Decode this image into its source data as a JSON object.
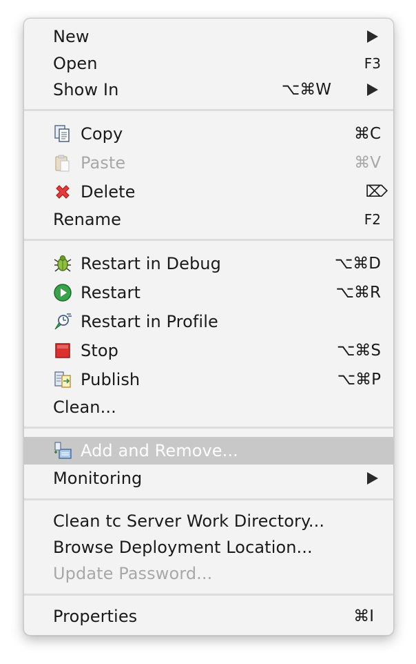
{
  "menu": {
    "new": {
      "label": "New"
    },
    "open": {
      "label": "Open",
      "shortcut": "F3"
    },
    "show_in": {
      "label": "Show In",
      "shortcut": "⌥⌘W"
    },
    "copy": {
      "label": "Copy",
      "shortcut": "⌘C",
      "icon": "copy-icon"
    },
    "paste": {
      "label": "Paste",
      "shortcut": "⌘V",
      "icon": "paste-icon"
    },
    "delete": {
      "label": "Delete",
      "shortcut": "⌦",
      "icon": "delete-icon"
    },
    "rename": {
      "label": "Rename",
      "shortcut": "F2"
    },
    "restart_debug": {
      "label": "Restart in Debug",
      "shortcut": "⌥⌘D",
      "icon": "debug-bug-icon"
    },
    "restart": {
      "label": "Restart",
      "shortcut": "⌥⌘R",
      "icon": "run-play-icon"
    },
    "restart_profile": {
      "label": "Restart in Profile",
      "icon": "profile-icon"
    },
    "stop": {
      "label": "Stop",
      "shortcut": "⌥⌘S",
      "icon": "stop-icon"
    },
    "publish": {
      "label": "Publish",
      "shortcut": "⌥⌘P",
      "icon": "publish-icon"
    },
    "clean": {
      "label": "Clean..."
    },
    "add_remove": {
      "label": "Add and Remove...",
      "icon": "add-remove-icon"
    },
    "monitoring": {
      "label": "Monitoring"
    },
    "clean_tc": {
      "label": "Clean tc Server Work Directory..."
    },
    "browse_deploy": {
      "label": "Browse Deployment Location..."
    },
    "update_password": {
      "label": "Update Password..."
    },
    "properties": {
      "label": "Properties",
      "shortcut": "⌘I"
    }
  },
  "colors": {
    "menu_bg": "#f3f3f3",
    "highlight": "#c8c8c8",
    "text": "#1a1a1a",
    "disabled_text": "#a8a8a8"
  }
}
